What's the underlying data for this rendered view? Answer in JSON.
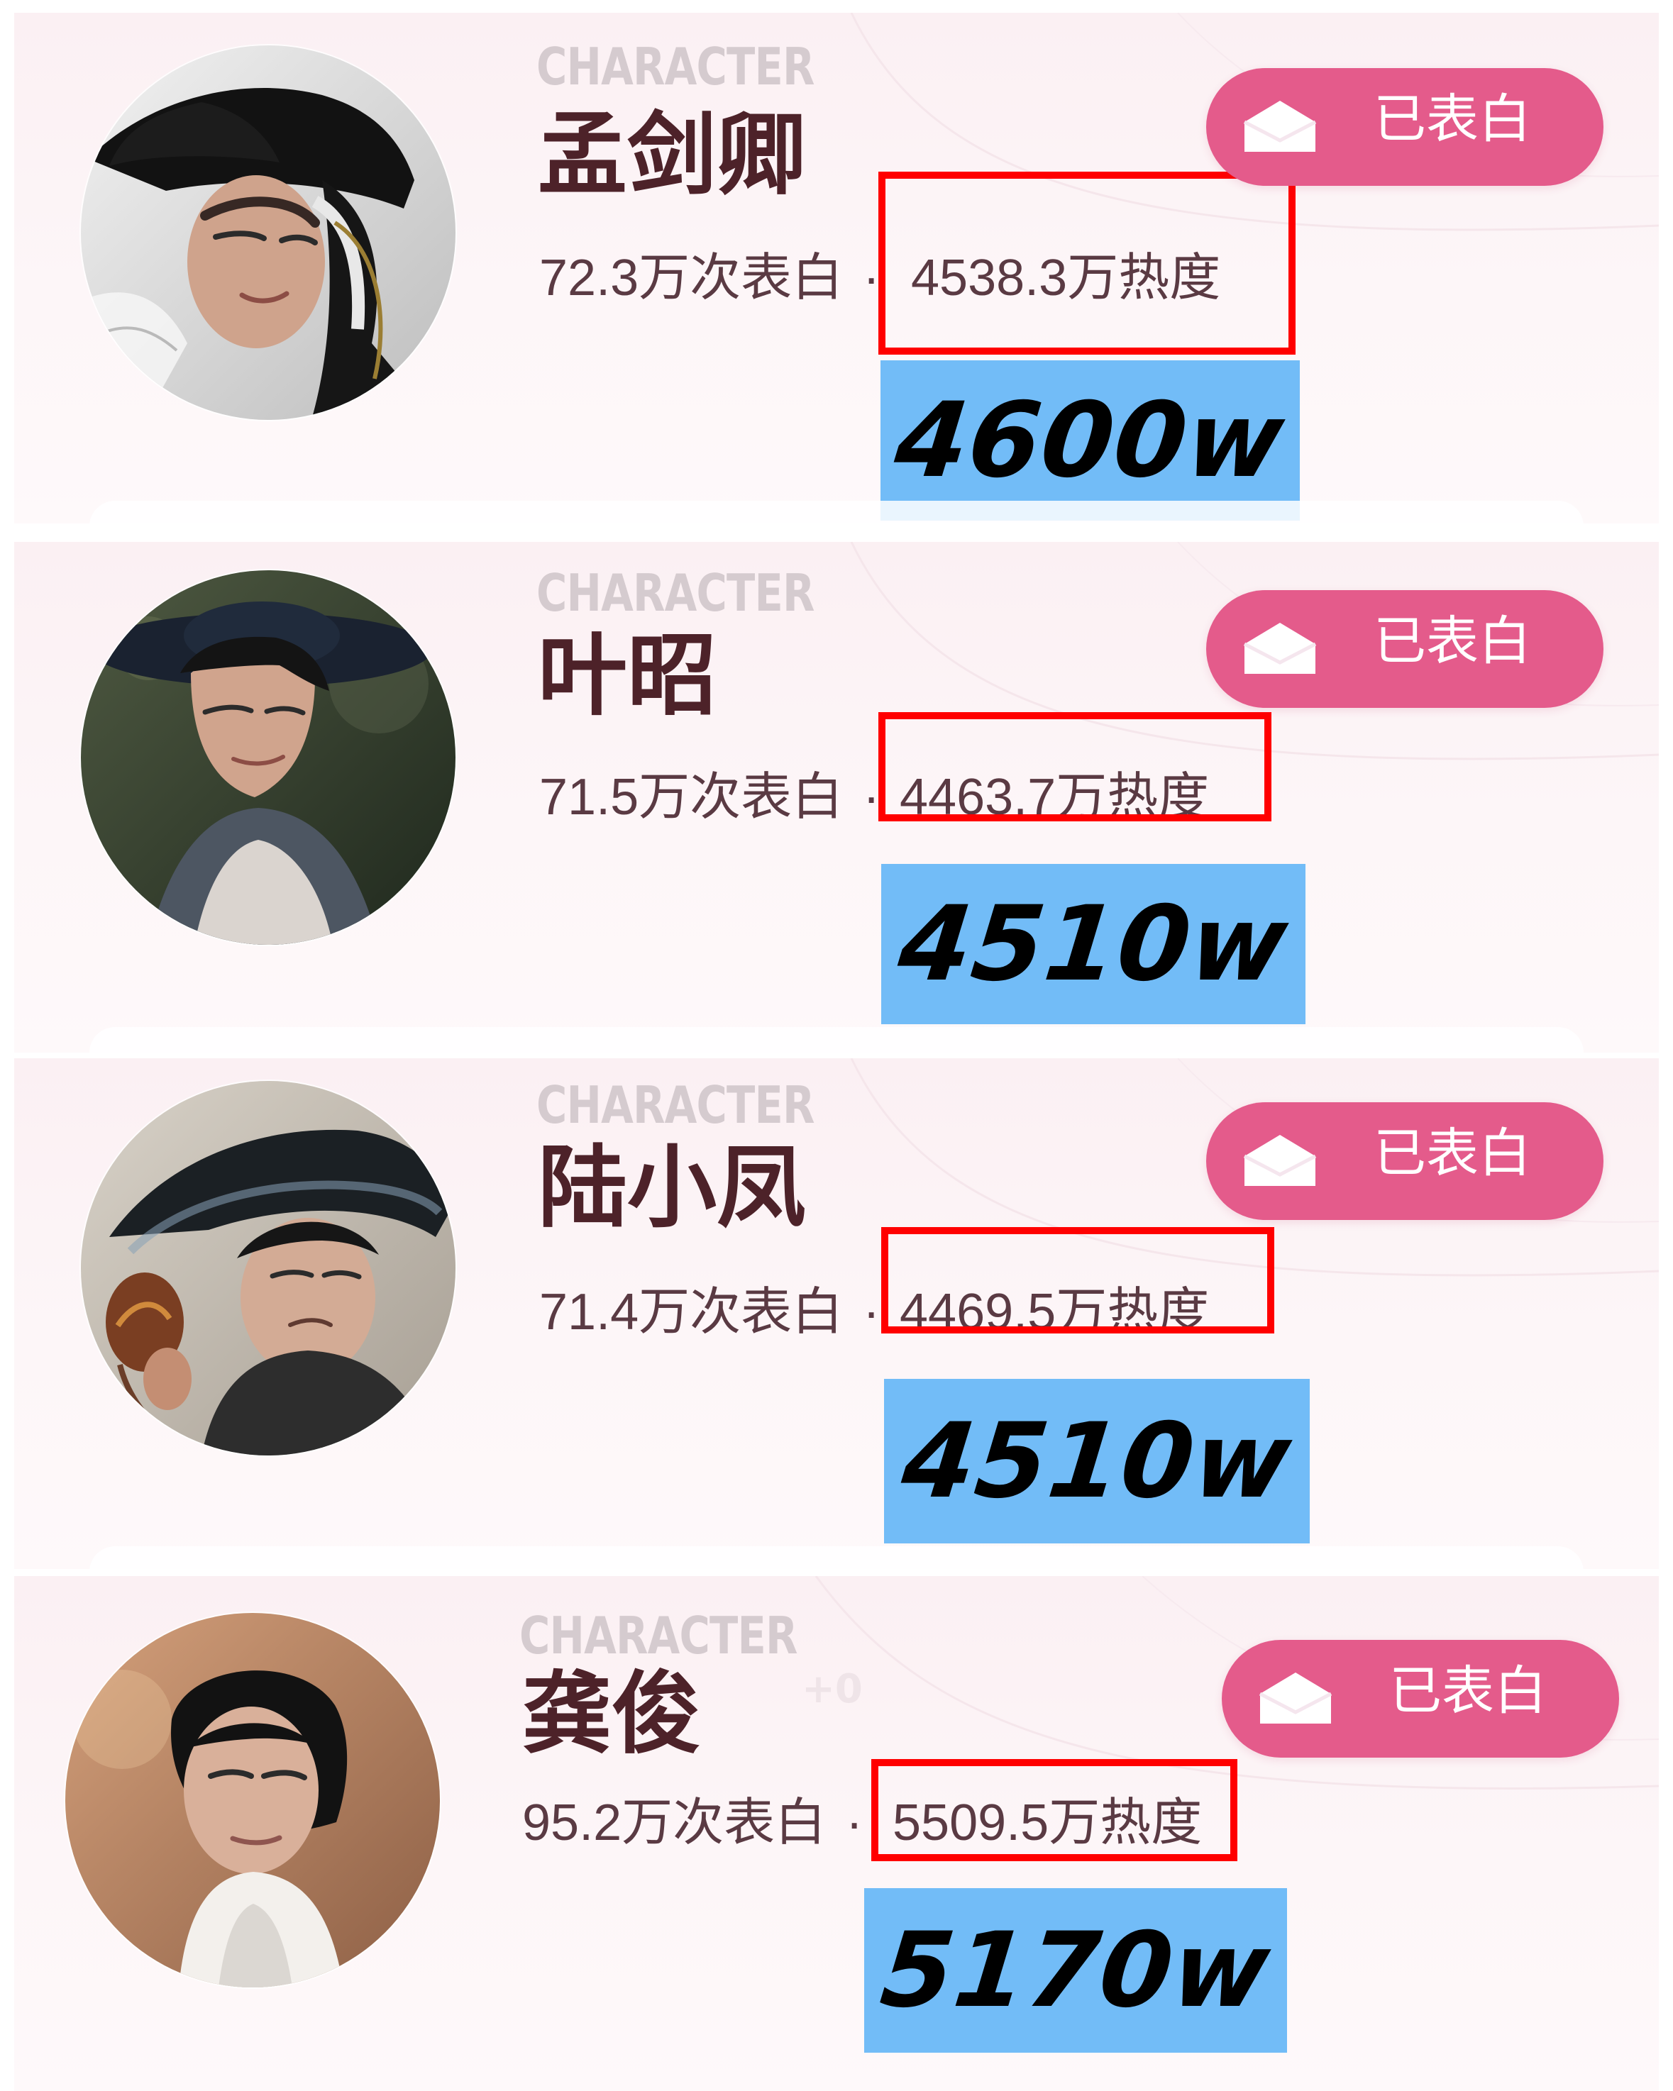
{
  "cards": [
    {
      "character_label": "CHARACTER",
      "name": "孟剑卿",
      "confessions": "72.3万次表白",
      "separator": "·",
      "heat": "4538.3万热度",
      "estimate": "4600w",
      "button_label": "已表白"
    },
    {
      "character_label": "CHARACTER",
      "name": "叶昭",
      "confessions": "71.5万次表白",
      "separator": "·",
      "heat": "4463.7万热度",
      "estimate": "4510w",
      "button_label": "已表白"
    },
    {
      "character_label": "CHARACTER",
      "name": "陆小凤",
      "confessions": "71.4万次表白",
      "separator": "·",
      "heat": "4469.5万热度",
      "estimate": "4510w",
      "button_label": "已表白"
    },
    {
      "character_label": "CHARACTER",
      "name": "龚俊",
      "confessions": "95.2万次表白",
      "separator": "·",
      "heat": "5509.5万热度",
      "estimate": "5170w",
      "button_label": "已表白",
      "faint_counter": "+0"
    }
  ],
  "colors": {
    "button": "#e45b8b",
    "heat_highlight": "#ff0000",
    "estimate_background": "#72bcf7",
    "name_text": "#4d2229"
  },
  "icons": {
    "button_icon": "envelope-icon"
  }
}
